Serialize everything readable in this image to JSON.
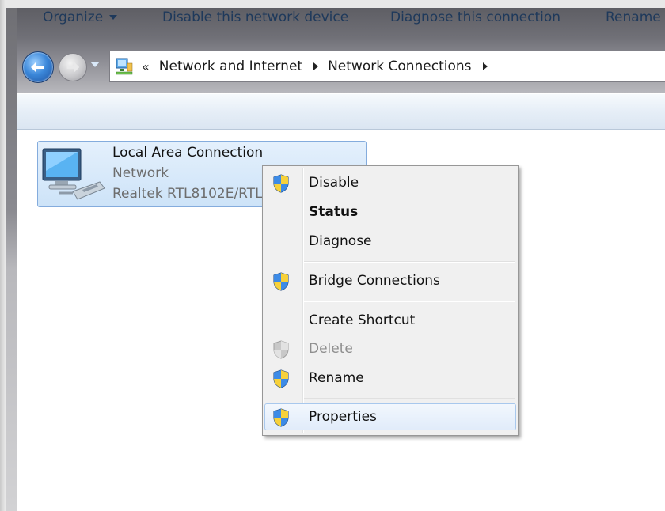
{
  "address": {
    "overflow_glyph": "«",
    "crumbs": [
      "Network and Internet",
      "Network Connections"
    ]
  },
  "toolbar": {
    "organize": "Organize",
    "disable": "Disable this network device",
    "diagnose": "Diagnose this connection",
    "rename": "Rename"
  },
  "connection": {
    "name": "Local Area Connection",
    "network": "Network",
    "device": "Realtek RTL8102E/RTL"
  },
  "context_menu": {
    "items": [
      {
        "label": "Disable",
        "icon": "uac-shield-icon"
      },
      {
        "label": "Status",
        "style": "bold"
      },
      {
        "label": "Diagnose"
      },
      {
        "label": "Bridge Connections",
        "icon": "uac-shield-icon"
      },
      {
        "label": "Create Shortcut"
      },
      {
        "label": "Delete",
        "icon": "uac-shield-icon",
        "state": "disabled"
      },
      {
        "label": "Rename",
        "icon": "uac-shield-icon"
      },
      {
        "label": "Properties",
        "icon": "uac-shield-icon",
        "state": "hover"
      }
    ]
  },
  "colors": {
    "accent": "#1e395b",
    "selection": "#cde3f8",
    "menu_bg": "#f0f0f0"
  }
}
